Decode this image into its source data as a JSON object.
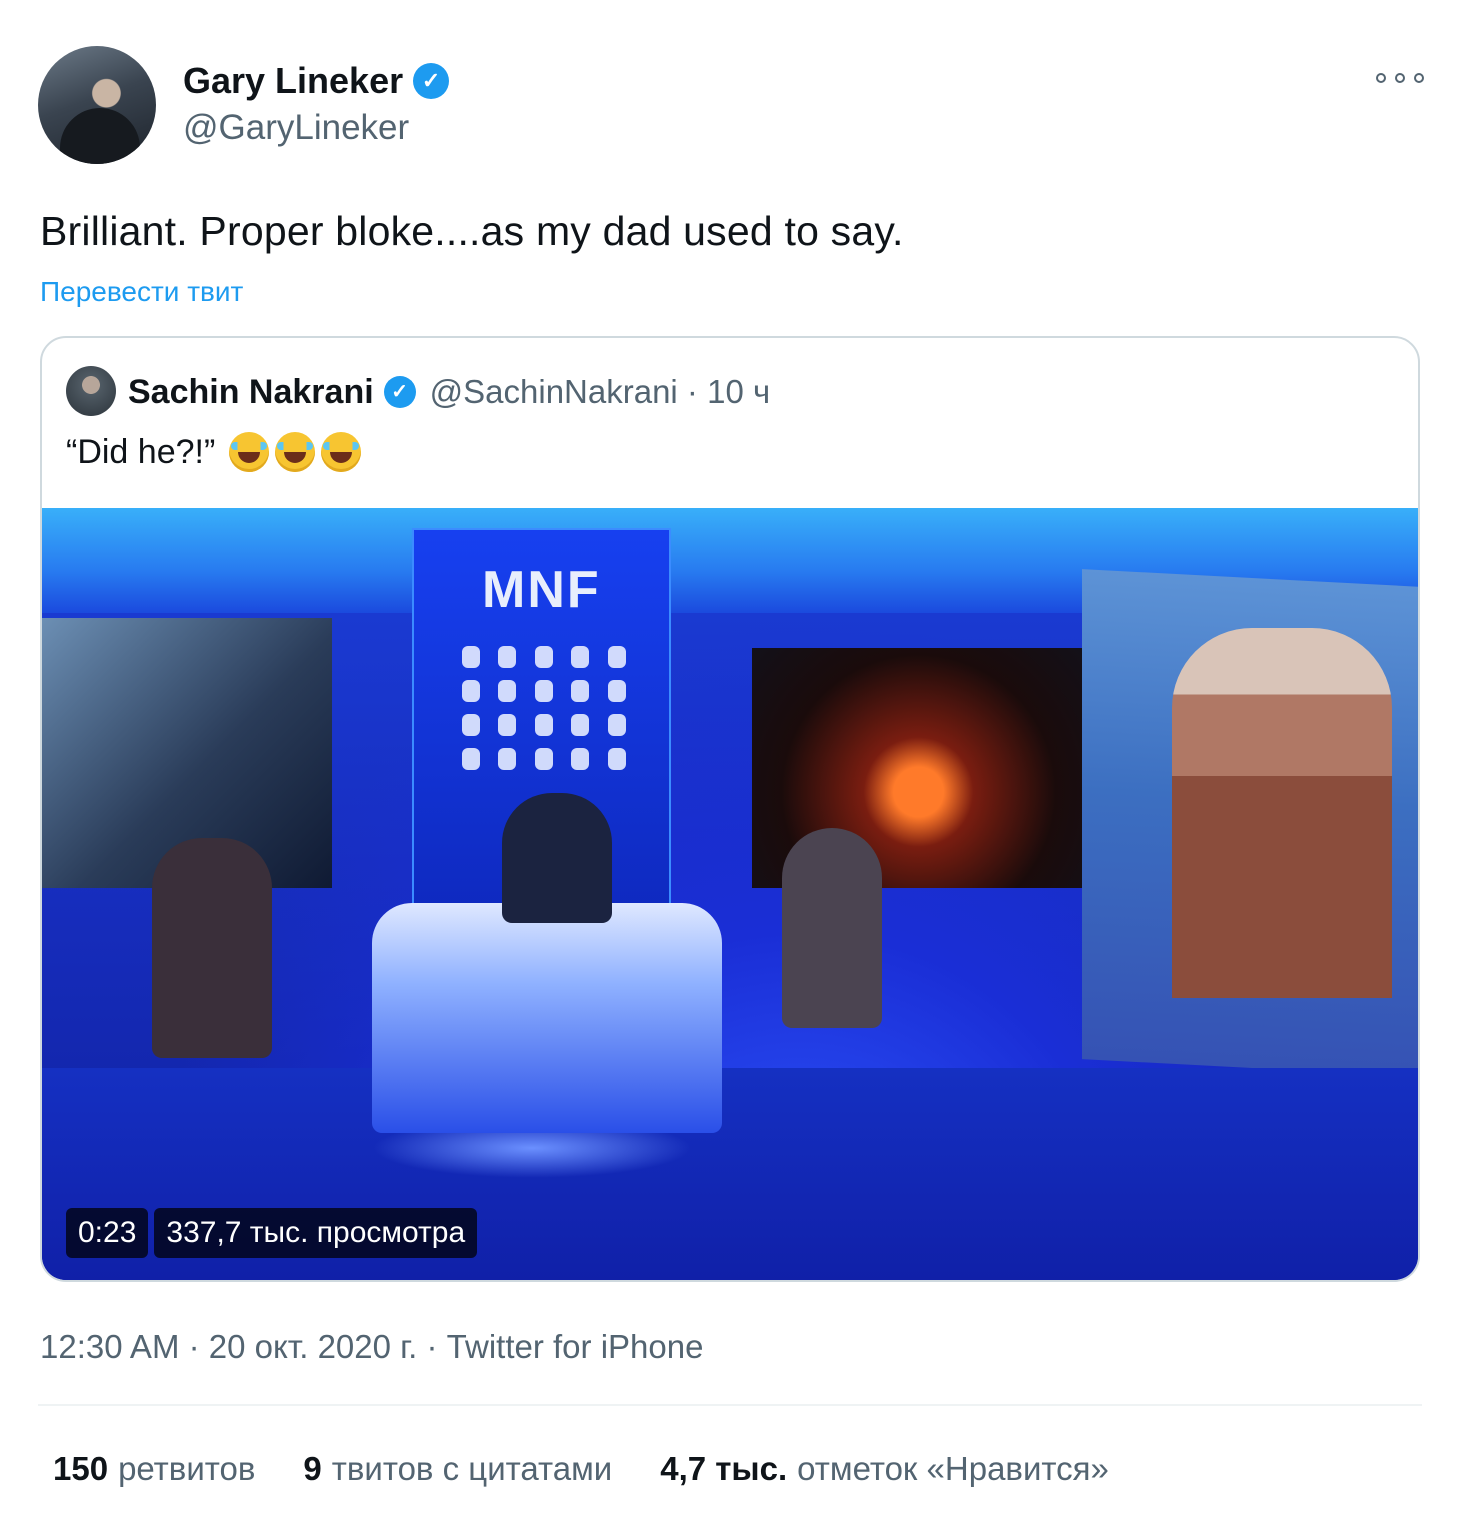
{
  "author": {
    "name": "Gary Lineker",
    "handle": "@GaryLineker",
    "verified": true
  },
  "tweet": {
    "text": "Brilliant. Proper bloke....as my dad used to say.",
    "translate_label": "Перевести твит"
  },
  "quoted": {
    "name": "Sachin Nakrani",
    "handle_time": "@SachinNakrani · 10 ч",
    "text": "“Did he?!”",
    "emoji": [
      "face-with-tears-of-joy-icon",
      "face-with-tears-of-joy-icon",
      "face-with-tears-of-joy-icon"
    ],
    "video": {
      "studio_logo": "MNF",
      "duration": "0:23",
      "views": "337,7 тыс. просмотра"
    }
  },
  "meta": "12:30 AM · 20 окт. 2020 г. · Twitter for iPhone",
  "stats": {
    "retweets_count": "150",
    "retweets_label": "ретвитов",
    "quotes_count": "9",
    "quotes_label": "твитов с цитатами",
    "likes_count": "4,7 тыс.",
    "likes_label": "отметок «Нравится»"
  },
  "colors": {
    "link": "#1d9bf0",
    "secondary_text": "#536471",
    "primary_text": "#0f1419"
  }
}
